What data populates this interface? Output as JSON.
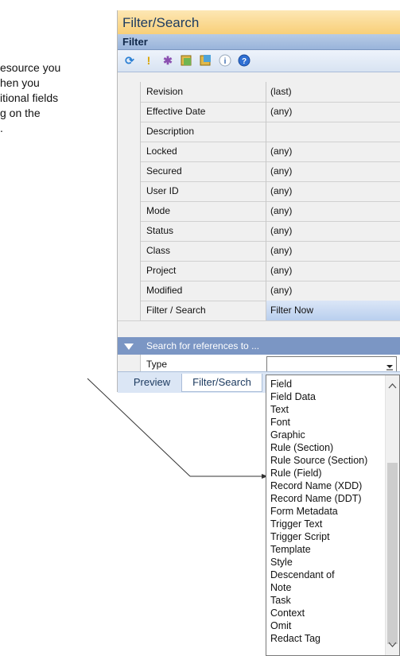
{
  "doc_text": [
    "esource you",
    "hen you",
    "itional fields",
    "g on the",
    "."
  ],
  "panel": {
    "title": "Filter/Search",
    "filter_header": "Filter",
    "toolbar_icons": [
      "refresh-icon",
      "exclamation-icon",
      "find-icon",
      "resource-icon",
      "resource-alt-icon",
      "info-icon",
      "help-icon"
    ],
    "rows": [
      {
        "name": "Revision",
        "value": "(last)"
      },
      {
        "name": "Effective Date",
        "value": "(any)"
      },
      {
        "name": "Description",
        "value": ""
      },
      {
        "name": "Locked",
        "value": "(any)"
      },
      {
        "name": "Secured",
        "value": "(any)"
      },
      {
        "name": "User ID",
        "value": "(any)"
      },
      {
        "name": "Mode",
        "value": "(any)"
      },
      {
        "name": "Status",
        "value": "(any)"
      },
      {
        "name": "Class",
        "value": "(any)"
      },
      {
        "name": "Project",
        "value": "(any)"
      },
      {
        "name": "Modified",
        "value": "(any)"
      },
      {
        "name": "Filter / Search",
        "value": "Filter Now"
      }
    ],
    "section_label": "Search for references to ...",
    "type_label": "Type",
    "type_value": "",
    "tabs": [
      "Preview",
      "Filter/Search"
    ]
  },
  "dropdown": {
    "items": [
      "Field",
      "Field Data",
      "Text",
      "Font",
      "Graphic",
      "Rule (Section)",
      "Rule Source (Section)",
      "Rule (Field)",
      "Record Name (XDD)",
      "Record Name (DDT)",
      "Form Metadata",
      "Trigger Text",
      "Trigger Script",
      "Template",
      "Style",
      "Descendant of",
      "Note",
      "Task",
      "Context",
      "Omit",
      "Redact Tag"
    ]
  },
  "colors": {
    "title_bg": "#f8cf78",
    "header_bg": "#99b4da",
    "section_bg": "#7b96c4",
    "selected_bg": "#b9cfee"
  }
}
